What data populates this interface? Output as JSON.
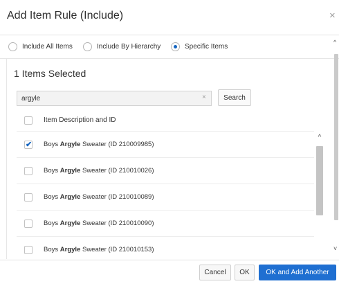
{
  "dialog": {
    "title": "Add Item Rule (Include)",
    "close_glyph": "×"
  },
  "rule_options": [
    {
      "label": "Include All Items",
      "selected": false
    },
    {
      "label": "Include By Hierarchy",
      "selected": false
    },
    {
      "label": "Specific Items",
      "selected": true
    }
  ],
  "selection": {
    "count_label": "1 Items Selected"
  },
  "search": {
    "value": "argyle",
    "clear_glyph": "×",
    "button_label": "Search"
  },
  "table": {
    "header_label": "Item Description and ID",
    "header_checked": false,
    "rows": [
      {
        "prefix": "Boys ",
        "match": "Argyle",
        "suffix": " Sweater (ID 210009985)",
        "checked": true
      },
      {
        "prefix": "Boys ",
        "match": "Argyle",
        "suffix": " Sweater (ID 210010026)",
        "checked": false
      },
      {
        "prefix": "Boys ",
        "match": "Argyle",
        "suffix": " Sweater (ID 210010089)",
        "checked": false
      },
      {
        "prefix": "Boys ",
        "match": "Argyle",
        "suffix": " Sweater (ID 210010090)",
        "checked": false
      },
      {
        "prefix": "Boys ",
        "match": "Argyle",
        "suffix": " Sweater (ID 210010153)",
        "checked": false
      }
    ]
  },
  "footer": {
    "cancel_label": "Cancel",
    "ok_label": "OK",
    "ok_add_label": "OK and Add Another"
  },
  "colors": {
    "accent": "#1f6fd1",
    "radio_selected": "#1565c0"
  }
}
